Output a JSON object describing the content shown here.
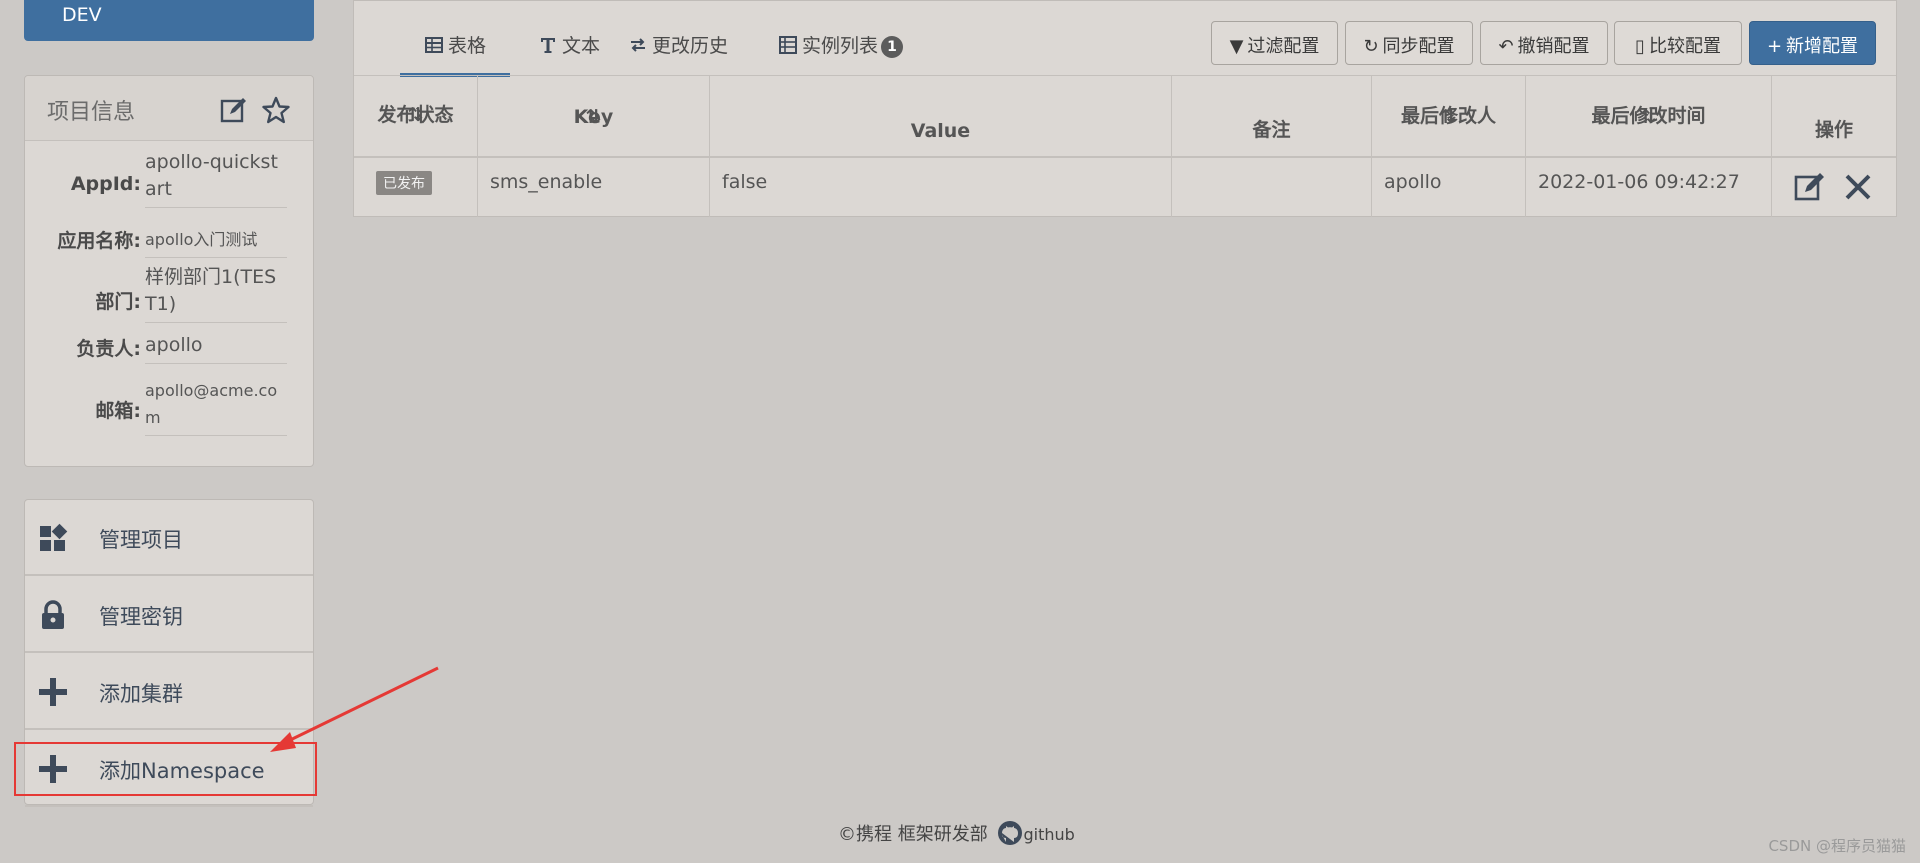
{
  "env": {
    "label": "DEV"
  },
  "info": {
    "title": "项目信息",
    "rows": [
      {
        "label": "AppId:",
        "value": "apollo-quickstart"
      },
      {
        "label": "应用名称:",
        "value": "apollo入门测试"
      },
      {
        "label": "部门:",
        "value": "样例部门1(TEST1)"
      },
      {
        "label": "负责人:",
        "value": "apollo"
      },
      {
        "label": "邮箱:",
        "value": "apollo@acme.com"
      }
    ]
  },
  "menu": {
    "items": [
      {
        "label": "管理项目",
        "icon": "dashboard-icon"
      },
      {
        "label": "管理密钥",
        "icon": "lock-icon"
      },
      {
        "label": "添加集群",
        "icon": "plus-icon"
      },
      {
        "label": "添加Namespace",
        "icon": "plus-icon"
      }
    ]
  },
  "tabs": [
    {
      "label": "表格",
      "icon": "table-icon"
    },
    {
      "label": "文本",
      "icon": "text-icon"
    },
    {
      "label": "更改历史",
      "icon": "history-icon"
    },
    {
      "label": "实例列表",
      "icon": "instance-icon",
      "badge": "1"
    }
  ],
  "toolbar": {
    "filter": "过滤配置",
    "sync": "同步配置",
    "revert": "撤销配置",
    "compare": "比较配置",
    "add": "新增配置"
  },
  "table": {
    "headers": {
      "status": "发布状态",
      "key": "Key",
      "value": "Value",
      "comment": "备注",
      "modifier": "最后修改人",
      "time": "最后修改时间",
      "ops": "操作"
    },
    "rows": [
      {
        "status": "已发布",
        "key": "sms_enable",
        "value": "false",
        "comment": "",
        "modifier": "apollo",
        "time": "2022-01-06 09:42:27"
      }
    ]
  },
  "footer": {
    "copyright": "©携程 框架研发部",
    "github": "github"
  },
  "watermark": "CSDN @程序员猫猫"
}
